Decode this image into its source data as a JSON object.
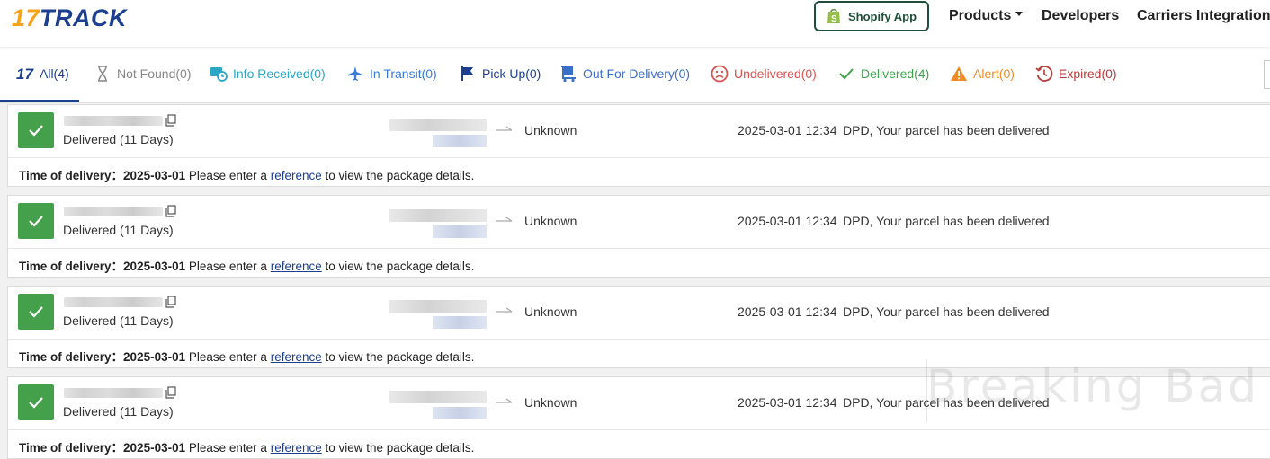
{
  "header": {
    "logo_number": "17",
    "logo_word": "TRACK",
    "shopify_label": "Shopify App",
    "nav": [
      {
        "label": "Products",
        "has_dropdown": true
      },
      {
        "label": "Developers"
      },
      {
        "label": "Carriers Integration"
      }
    ]
  },
  "tabs": [
    {
      "label": "All(4)",
      "icon": "17-logo-icon",
      "color": "#1c3f8f",
      "active": true
    },
    {
      "label": "Not Found(0)",
      "icon": "hourglass-icon",
      "color": "#888888"
    },
    {
      "label": "Info Received(0)",
      "icon": "info-received-clock-icon",
      "color": "#2aa6c6"
    },
    {
      "label": "In Transit(0)",
      "icon": "airplane-icon",
      "color": "#3a7bd5"
    },
    {
      "label": "Pick Up(0)",
      "icon": "flag-icon",
      "color": "#1c3f8f"
    },
    {
      "label": "Out For Delivery(0)",
      "icon": "delivery-cart-icon",
      "color": "#3a6fc8"
    },
    {
      "label": "Undelivered(0)",
      "icon": "sad-face-icon",
      "color": "#d9534f"
    },
    {
      "label": "Delivered(4)",
      "icon": "checkmark-icon",
      "color": "#3fa34d"
    },
    {
      "label": "Alert(0)",
      "icon": "warning-triangle-icon",
      "color": "#f08a24"
    },
    {
      "label": "Expired(0)",
      "icon": "history-clock-icon",
      "color": "#b73a3a"
    }
  ],
  "shipments": [
    {
      "status": "Delivered (11 Days)",
      "destination": "Unknown",
      "event_time": "2025-03-01 12:34",
      "event_text": "DPD, Your parcel has been delivered",
      "delivery_label": "Time of delivery：",
      "delivery_date": "2025-03-01",
      "delivery_text_before": "Please enter a",
      "delivery_link": "reference",
      "delivery_text_after": "to view the package details."
    },
    {
      "status": "Delivered (11 Days)",
      "destination": "Unknown",
      "event_time": "2025-03-01 12:34",
      "event_text": "DPD, Your parcel has been delivered",
      "delivery_label": "Time of delivery：",
      "delivery_date": "2025-03-01",
      "delivery_text_before": "Please enter a",
      "delivery_link": "reference",
      "delivery_text_after": "to view the package details."
    },
    {
      "status": "Delivered (11 Days)",
      "destination": "Unknown",
      "event_time": "2025-03-01 12:34",
      "event_text": "DPD, Your parcel has been delivered",
      "delivery_label": "Time of delivery：",
      "delivery_date": "2025-03-01",
      "delivery_text_before": "Please enter a",
      "delivery_link": "reference",
      "delivery_text_after": "to view the package details."
    },
    {
      "status": "Delivered (11 Days)",
      "destination": "Unknown",
      "event_time": "2025-03-01 12:34",
      "event_text": "DPD, Your parcel has been delivered",
      "delivery_label": "Time of delivery：",
      "delivery_date": "2025-03-01",
      "delivery_text_before": "Please enter a",
      "delivery_link": "reference",
      "delivery_text_after": "to view the package details."
    }
  ],
  "watermark": "Breaking Bad",
  "colors": {
    "brand_orange": "#f7a21b",
    "brand_blue": "#1c3f8f",
    "delivered_green": "#44a04a",
    "shopify_green": "#1f4f3b"
  }
}
